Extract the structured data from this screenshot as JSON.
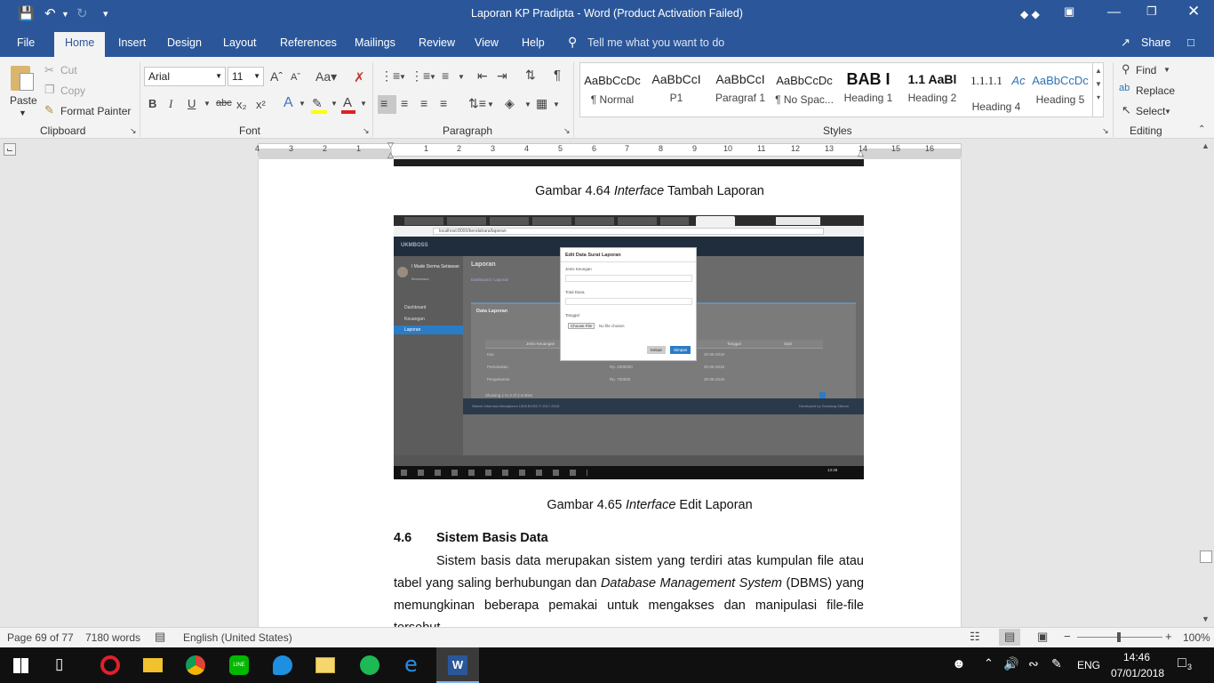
{
  "titlebar": {
    "title": "Laporan KP Pradipta  -  Word (Product Activation Failed)",
    "glyphs": "◆ ◆"
  },
  "tabs": [
    {
      "label": "File"
    },
    {
      "label": "Home"
    },
    {
      "label": "Insert"
    },
    {
      "label": "Design"
    },
    {
      "label": "Layout"
    },
    {
      "label": "References"
    },
    {
      "label": "Mailings"
    },
    {
      "label": "Review"
    },
    {
      "label": "View"
    },
    {
      "label": "Help"
    }
  ],
  "tell_me": "Tell me what you want to do",
  "share": "Share",
  "clipboard": {
    "paste": "Paste",
    "cut": "Cut",
    "copy": "Copy",
    "format_painter": "Format Painter",
    "label": "Clipboard"
  },
  "font": {
    "name": "Arial",
    "size": "11",
    "label": "Font"
  },
  "paragraph": {
    "label": "Paragraph"
  },
  "styles": {
    "label": "Styles",
    "items": [
      {
        "preview": "AaBbCcDc",
        "name": "¶ Normal"
      },
      {
        "preview": "AaBbCcI",
        "name": "P1"
      },
      {
        "preview": "AaBbCcI",
        "name": "Paragraf 1"
      },
      {
        "preview": "AaBbCcDc",
        "name": "¶ No Spac..."
      },
      {
        "preview": "BAB I",
        "name": "Heading 1"
      },
      {
        "preview": "1.1  AaBl",
        "name": "Heading 2"
      },
      {
        "preview": "1.1.1.1",
        "name": "Heading 4"
      },
      {
        "preview": "Ac",
        "name": ""
      },
      {
        "preview": "AaBbCcDc",
        "name": "Heading 5"
      }
    ]
  },
  "editing": {
    "find": "Find",
    "replace": "Replace",
    "select": "Select",
    "label": "Editing"
  },
  "ruler": {
    "numbers": [
      "4",
      "3",
      "2",
      "1",
      "1",
      "2",
      "3",
      "4",
      "5",
      "6",
      "7",
      "8",
      "9",
      "10",
      "11",
      "12",
      "13",
      "14",
      "15",
      "16"
    ]
  },
  "document": {
    "caption_464_pre": "Gambar 4.64 ",
    "caption_464_em": "Interface",
    "caption_464_post": " Tambah Laporan",
    "caption_465_pre": "Gambar 4.65 ",
    "caption_465_em": "Interface",
    "caption_465_post": " Edit Laporan",
    "heading_num": "4.6",
    "heading_text": "Sistem Basis Data",
    "para_1": "Sistem basis data merupakan sistem yang terdiri atas kumpulan file atau",
    "para_2a": "tabel yang saling berhubungan dan ",
    "para_2em": "Database Management System",
    "para_2b": " (DBMS) yang",
    "para_3": "memungkinan beberapa pemakai untuk mengakses dan manipulasi file-file",
    "para_4": "tersebut."
  },
  "screenshot": {
    "url": "localhost:8000/bendahara/laporan",
    "brand": "UKMBOSS",
    "user_name": "I Made Derma Setiawan",
    "user_role": "Bendahara",
    "menu": [
      "Dashboard",
      "Keuangan",
      "Laporan"
    ],
    "page_title": "Laporan",
    "breadcrumb": "Dashboard / Laporan",
    "panel_title": "Data Laporan",
    "modal_title": "Edit Data Surat Laporan",
    "field_1": "Jenis Keungan",
    "field_2": "Total Dana",
    "field_3": "Tanggal",
    "choose_file": "Choose File",
    "no_file": "No file chosen",
    "btn_keluar": "Keluar",
    "btn_simpan": "Simpan",
    "footer_left": "Sistem Informasi Manajemen UKM BOSS © 2017-2018",
    "footer_right": "Developed by Gondang Silicom",
    "rows": [
      {
        "a": "Kas",
        "b": "",
        "c": "20-06-2018"
      },
      {
        "a": "Pemasukan",
        "b": "Rp. 2000000",
        "c": "20-06-2018"
      },
      {
        "a": "Pengeluaran",
        "b": "Rp. 700000",
        "c": "20-06-2018"
      }
    ],
    "showing": "Showing 1 to 3 of 3 entries",
    "col_headers": [
      "Jenis Keuangan",
      "Tanggal",
      "Opsi"
    ],
    "clock": "13:48"
  },
  "status": {
    "page": "Page 69 of 77",
    "words": "7180 words",
    "language": "English (United States)",
    "zoom": "100%"
  },
  "taskbar": {
    "lang": "ENG",
    "time": "14:46",
    "date": "07/01/2018",
    "notif": "3"
  }
}
